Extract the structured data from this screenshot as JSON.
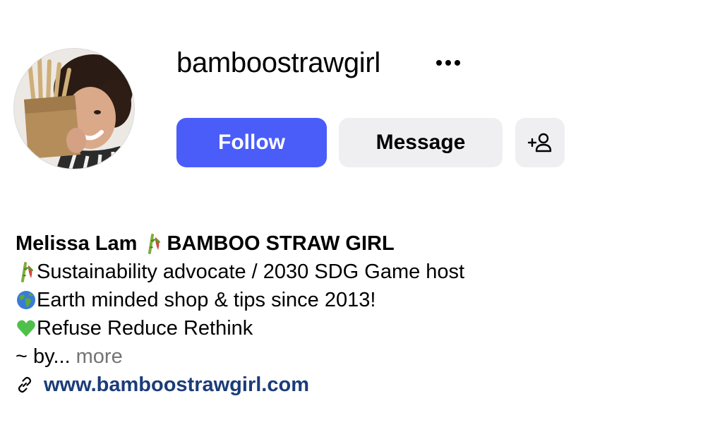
{
  "profile": {
    "username": "bamboostrawgirl",
    "follow_label": "Follow",
    "message_label": "Message"
  },
  "icons": {
    "more": "more-horizontal-icon",
    "add_user": "add-person-icon",
    "bamboo": "bamboo-emoji-icon",
    "globe": "globe-emoji-icon",
    "heart": "green-heart-emoji-icon",
    "link": "link-icon"
  },
  "colors": {
    "follow_button": "#4a5df9",
    "secondary_button": "#efeff2",
    "link": "#1b3c7a",
    "muted": "#737373"
  },
  "bio": {
    "name": "Melissa Lam",
    "title": "BAMBOO STRAW GIRL",
    "line1": "Sustainability advocate / 2030 SDG Game host",
    "line2": "Earth minded shop & tips since 2013!",
    "line3": "Refuse Reduce Rethink",
    "line4": "~ by...",
    "more_label": "more",
    "website": "www.bamboostrawgirl.com"
  }
}
